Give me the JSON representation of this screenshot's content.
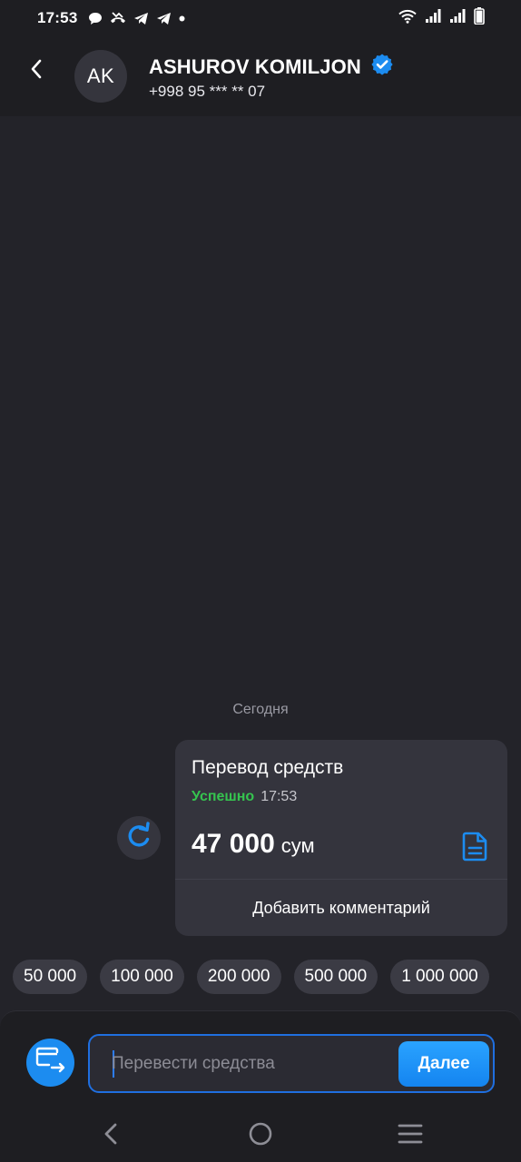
{
  "status_bar": {
    "time": "17:53",
    "left_icons": [
      "chat-bubble-icon",
      "missed-call-icon",
      "telegram-icon",
      "telegram-icon",
      "dot-icon"
    ],
    "right_icons": [
      "wifi-icon",
      "signal-icon",
      "signal-icon",
      "battery-icon"
    ]
  },
  "header": {
    "avatar_initials": "AK",
    "contact_name": "ASHUROV KOMILJON",
    "contact_phone": "+998 95 *** ** 07",
    "verified_color": "#1c8cf0"
  },
  "chat": {
    "date_label": "Сегодня",
    "transfer": {
      "title": "Перевод средств",
      "status": "Успешно",
      "time": "17:53",
      "amount": "47 000",
      "currency": "сум",
      "comment_button": "Добавить комментарий",
      "status_color": "#35c44f"
    }
  },
  "quick_amounts": [
    "50 000",
    "100 000",
    "200 000",
    "500 000",
    "1 000 000"
  ],
  "input_panel": {
    "placeholder": "Перевести средства",
    "value": "",
    "next_button": "Далее",
    "accent_color": "#1c8cf0"
  },
  "nav_bar": {
    "icons": [
      "back-icon",
      "home-icon",
      "recents-icon"
    ]
  }
}
